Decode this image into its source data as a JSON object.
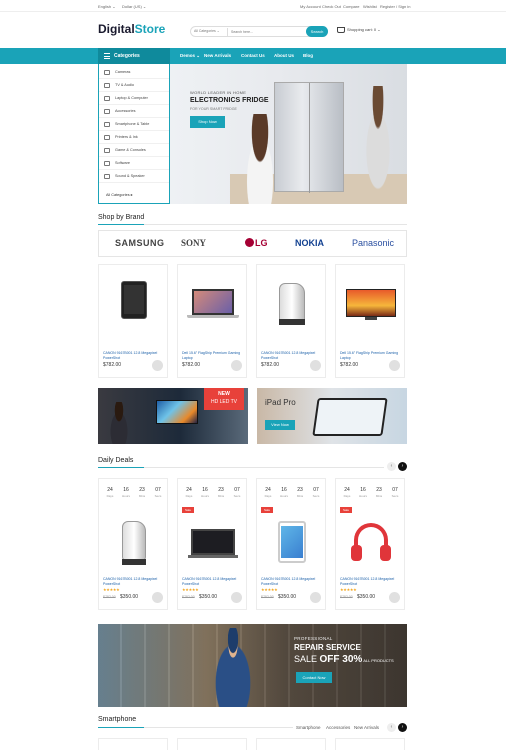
{
  "topbar": {
    "language": "English ⌄",
    "currency": "Dollar (US) ⌄",
    "links": [
      "My Account",
      "Check Out",
      "Compare",
      "Wishlist",
      "Register / Sign in"
    ]
  },
  "header": {
    "logo_a": "Digital",
    "logo_b": "Store",
    "category_select": "All Categories ⌄",
    "search_placeholder": "Search here...",
    "search_button": "Search",
    "cart_label": "Shopping cart: 0 ⌄"
  },
  "nav": {
    "categories_label": "Categories",
    "links": [
      "Demos ⌄",
      "New Arrivals",
      "Contact Us",
      "About Us",
      "Blog"
    ]
  },
  "sidebar": {
    "items": [
      "Cameras",
      "TV & Audio",
      "Laptop & Computer",
      "Accessories",
      "Smartphone & Table",
      "Printers & Ink",
      "Game & Consoles",
      "Software",
      "Sound & Speaker"
    ],
    "all_label": "All Categories ▸"
  },
  "hero": {
    "small": "WORLD LEADER IN HOME",
    "big": "ELECTRONICS FRIDGE",
    "sub": "FOR YOUR SMART FRIDGE",
    "button": "Shop Now"
  },
  "brands": {
    "title": "Shop by Brand",
    "list": [
      "SAMSUNG",
      "SONY",
      "LG",
      "NOKIA",
      "Panasonic"
    ]
  },
  "products": [
    {
      "name": "CANON 9167B001 12.8 Megapixel PowerShot",
      "price": "$782.00"
    },
    {
      "name": "Dell 15.6\" FlagShip Premium Gaming Laptop",
      "price": "$782.00"
    },
    {
      "name": "CANON 9167B001 12.8 Megapixel PowerShot",
      "price": "$782.00"
    },
    {
      "name": "Dell 15.6\" FlagShip Premium Gaming Laptop",
      "price": "$782.00"
    }
  ],
  "promo": {
    "tv_l1": "NEW",
    "tv_l2": "HD LED TV",
    "ipad_title": "iPad Pro",
    "ipad_button": "View Now"
  },
  "deals": {
    "title": "Daily Deals",
    "timer_units": [
      "Days",
      "Hours",
      "Mins",
      "Secs"
    ],
    "timer_values": [
      "24",
      "16",
      "23",
      "07"
    ],
    "sale_label": "Sale",
    "stars": "★★★★★",
    "items": [
      {
        "name": "CANON 9167B001 12.8 Megapixel PowerShot",
        "old": "$782.00",
        "new": "$350.00",
        "sale": false
      },
      {
        "name": "CANON 9167B001 12.8 Megapixel PowerShot",
        "old": "$782.00",
        "new": "$350.00",
        "sale": true
      },
      {
        "name": "CANON 9167B001 12.8 Megapixel PowerShot",
        "old": "$782.00",
        "new": "$350.00",
        "sale": true
      },
      {
        "name": "CANON 9167B001 12.8 Megapixel PowerShot",
        "old": "$782.00",
        "new": "$350.00",
        "sale": true
      }
    ]
  },
  "repair": {
    "l1": "PROFESSIONAL",
    "l2": "REPAIR SERVICE",
    "l3a": "SALE ",
    "l3b": "OFF 30%",
    "l3c": " ALL PRODUCTS",
    "button": "Contact Now"
  },
  "smartphone": {
    "title": "Smartphone",
    "tabs": [
      "Smartphone",
      "Accessories",
      "New Arrivals"
    ]
  },
  "colors": {
    "accent": "#1aa3b8",
    "sale": "#e8413a",
    "star": "#f3a51b"
  }
}
